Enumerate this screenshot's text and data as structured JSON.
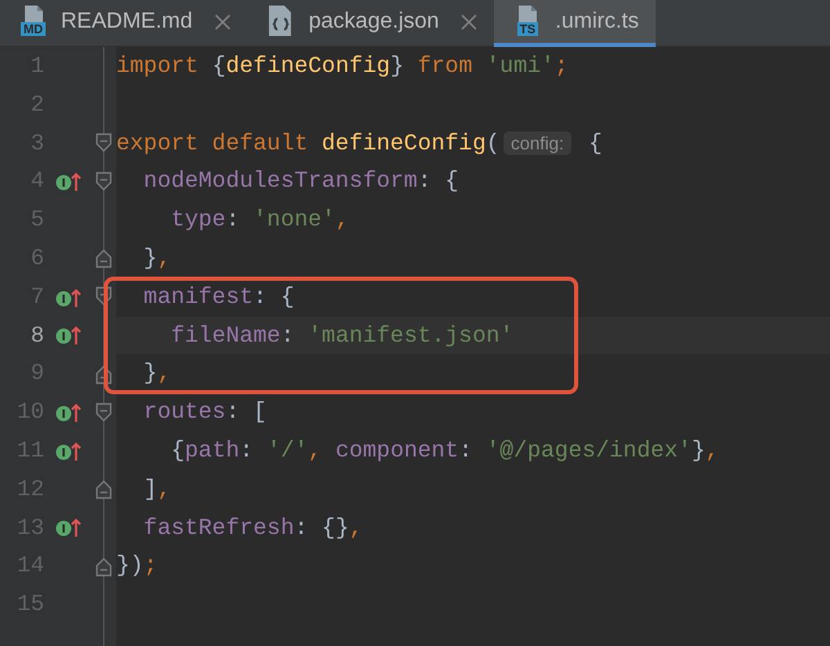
{
  "tabs": [
    {
      "label": "README.md",
      "kind": "md",
      "icon_label": "MD",
      "selected": false,
      "close_visible": true
    },
    {
      "label": "package.json",
      "kind": "json",
      "selected": false,
      "close_visible": true
    },
    {
      "label": ".umirc.ts",
      "kind": "ts",
      "icon_label": "TS",
      "selected": true
    }
  ],
  "lines": [
    {
      "number": "1",
      "tokens": [
        {
          "kind": "kw",
          "text": "import"
        },
        {
          "kind": "punct",
          "text": " {"
        },
        {
          "kind": "fn",
          "text": "defineConfig"
        },
        {
          "kind": "punct",
          "text": "}"
        },
        {
          "kind": "kw",
          "text": " from"
        },
        {
          "kind": "str",
          "text": " 'umi'"
        },
        {
          "kind": "sep",
          "text": ";"
        }
      ]
    },
    {
      "number": "2"
    },
    {
      "number": "3",
      "fold_start": true,
      "tokens": [
        {
          "kind": "kw",
          "text": "export default"
        },
        {
          "kind": "fn",
          "text": " defineConfig"
        },
        {
          "kind": "punct",
          "text": "("
        },
        {
          "kind": "hint",
          "text": "config:"
        },
        {
          "kind": "punct",
          "text": " {"
        }
      ]
    },
    {
      "number": "4",
      "marker": true,
      "fold_start": true,
      "tokens": [
        {
          "kind": "prop",
          "text": "  nodeModulesTransform"
        },
        {
          "kind": "punct",
          "text": ": {"
        }
      ]
    },
    {
      "number": "5",
      "tokens": [
        {
          "kind": "prop",
          "text": "    type"
        },
        {
          "kind": "punct",
          "text": ": "
        },
        {
          "kind": "str",
          "text": "'none'"
        },
        {
          "kind": "sep",
          "text": ","
        }
      ]
    },
    {
      "number": "6",
      "fold_end": true,
      "tokens": [
        {
          "kind": "punct",
          "text": "  }"
        },
        {
          "kind": "sep",
          "text": ","
        }
      ]
    },
    {
      "number": "7",
      "marker": true,
      "fold_start": true,
      "boxed": true,
      "tokens": [
        {
          "kind": "prop",
          "text": "  manifest"
        },
        {
          "kind": "punct",
          "text": ": {"
        }
      ]
    },
    {
      "number": "8",
      "marker": true,
      "current": true,
      "boxed": true,
      "tokens": [
        {
          "kind": "prop",
          "text": "    fileName"
        },
        {
          "kind": "punct",
          "text": ": "
        },
        {
          "kind": "str",
          "text": "'manifest.json'"
        }
      ]
    },
    {
      "number": "9",
      "fold_end": true,
      "boxed": true,
      "tokens": [
        {
          "kind": "punct",
          "text": "  }"
        },
        {
          "kind": "sep",
          "text": ","
        }
      ]
    },
    {
      "number": "10",
      "marker": true,
      "fold_start": true,
      "tokens": [
        {
          "kind": "prop",
          "text": "  routes"
        },
        {
          "kind": "punct",
          "text": ": ["
        }
      ]
    },
    {
      "number": "11",
      "marker": true,
      "tokens": [
        {
          "kind": "punct",
          "text": "    {"
        },
        {
          "kind": "prop",
          "text": "path"
        },
        {
          "kind": "punct",
          "text": ": "
        },
        {
          "kind": "str",
          "text": "'/'"
        },
        {
          "kind": "sep",
          "text": ", "
        },
        {
          "kind": "prop",
          "text": "component"
        },
        {
          "kind": "punct",
          "text": ": "
        },
        {
          "kind": "str",
          "text": "'@/pages/index'"
        },
        {
          "kind": "punct",
          "text": "}"
        },
        {
          "kind": "sep",
          "text": ","
        }
      ]
    },
    {
      "number": "12",
      "fold_end": true,
      "tokens": [
        {
          "kind": "punct",
          "text": "  ]"
        },
        {
          "kind": "sep",
          "text": ","
        }
      ]
    },
    {
      "number": "13",
      "marker": true,
      "tokens": [
        {
          "kind": "prop",
          "text": "  fastRefresh"
        },
        {
          "kind": "punct",
          "text": ": {}"
        },
        {
          "kind": "sep",
          "text": ","
        }
      ]
    },
    {
      "number": "14",
      "fold_end": true,
      "tokens": [
        {
          "kind": "punct",
          "text": "})"
        },
        {
          "kind": "sep",
          "text": ";"
        }
      ]
    },
    {
      "number": "15"
    }
  ]
}
